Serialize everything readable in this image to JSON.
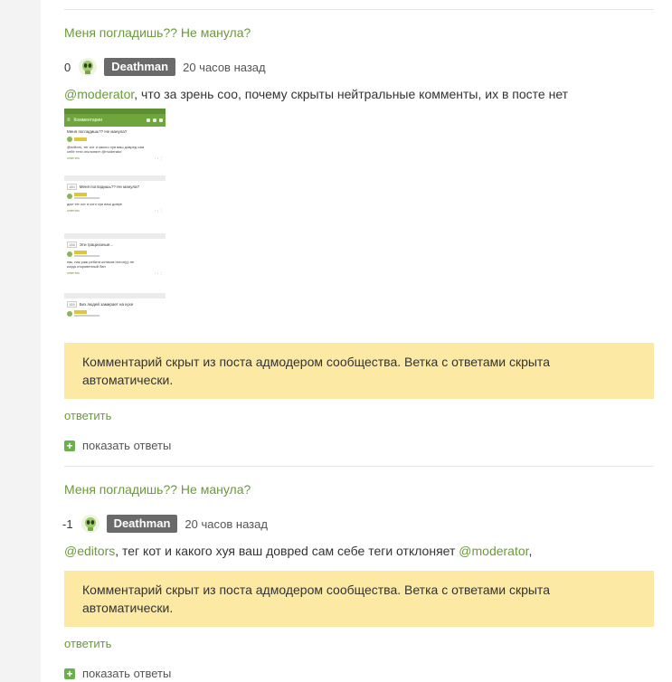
{
  "colors": {
    "accent": "#6a9a3a",
    "badge": "#6a6a6a",
    "notice": "#fbe9a4",
    "plus": "#6ab04c"
  },
  "comments": [
    {
      "post_title": "Меня погладишь?? Не манула?",
      "rating": "0",
      "author": "Deathman",
      "time": "20 часов назад",
      "mention": "@moderator",
      "text": ", что за зрень соо, почему скрыты нейтральные комменты, их в посте нет",
      "image": {
        "appbar_title": "Комментарии",
        "cards": [
          {
            "num": "",
            "title": "Меня погладишь?? Не манула?",
            "line1": "@editors, тег кот и какого хуя ваш довред сам",
            "line2": "себе теги отклоняет @moderator",
            "reply": "ответить"
          },
          {
            "num": "160",
            "title": "Меня погладишь?? Не манула?",
            "line1": "дые тег кот и кого хуя ваш довре",
            "line2": "",
            "reply": "ответить"
          },
          {
            "num": "158",
            "title": "Эти грациозные...",
            "line1": "пак, пак ржж ребята котиков потоп(у) не",
            "line2": "когда откровенный бан",
            "reply": "ответить"
          },
          {
            "num": "155",
            "title": "Без людей замирает на кухе",
            "line1": "",
            "line2": "",
            "reply": ""
          }
        ]
      },
      "notice": "Комментарий скрыт из поста адмодером сообщества. Ветка с ответами скрыта автоматически.",
      "reply": "ответить",
      "show_replies": "показать ответы"
    },
    {
      "post_title": "Меня погладишь?? Не манула?",
      "rating": "-1",
      "author": "Deathman",
      "time": "20 часов назад",
      "mention1": "@editors",
      "text": ", тег кот и какого хуя ваш доврed сам себе теги отклоняет ",
      "mention2": "@moderator",
      "text_end": ",",
      "notice": "Комментарий скрыт из поста адмодером сообщества. Ветка с ответами скрыта автоматически.",
      "reply": "ответить",
      "show_replies": "показать ответы"
    }
  ]
}
